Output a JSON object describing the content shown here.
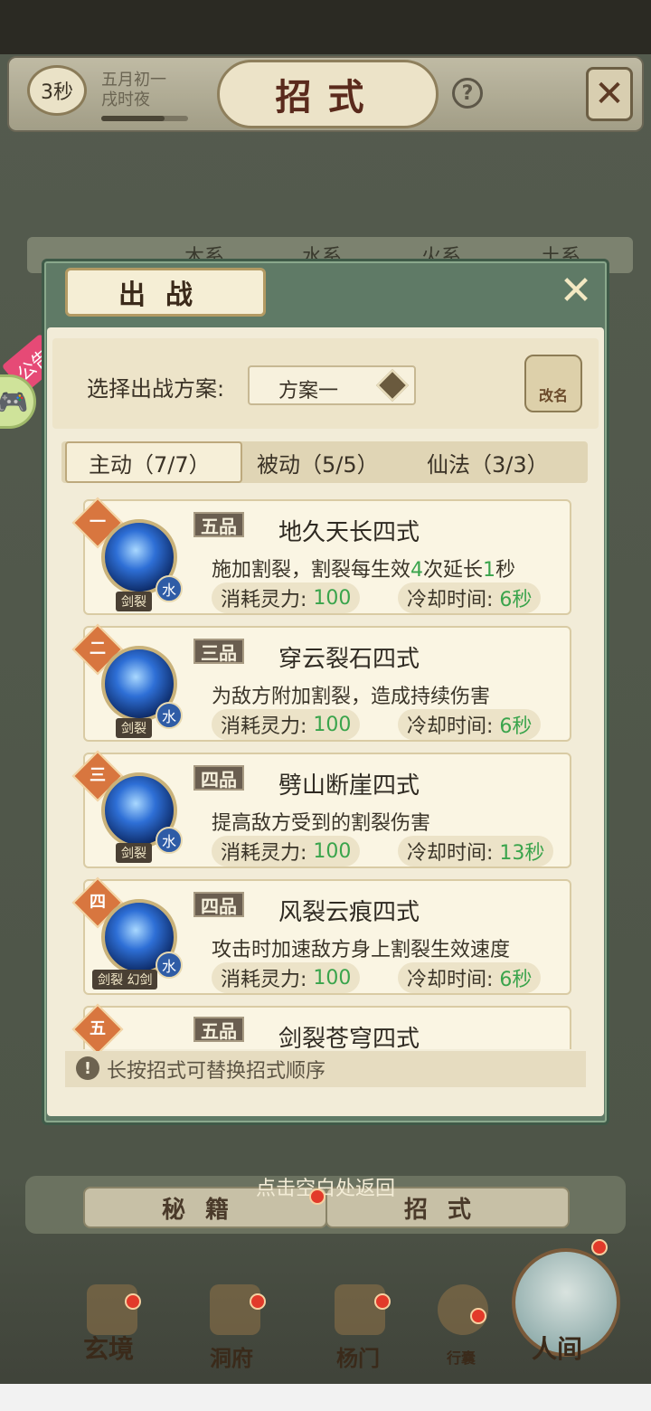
{
  "header": {
    "timer": "3秒",
    "date_line1": "五月初一",
    "date_line2": "戌时夜",
    "title": "招式",
    "help": "?"
  },
  "background_tabs": [
    "木系",
    "水系",
    "火系",
    "土系"
  ],
  "notice_tag": "公告",
  "modal": {
    "title": "出战",
    "plan_label": "选择出战方案:",
    "plan_value": "方案一",
    "rename_label": "改名",
    "tabs": [
      {
        "label": "主动（7/7）",
        "active": true
      },
      {
        "label": "被动（5/5）",
        "active": false
      },
      {
        "label": "仙法（3/3）",
        "active": false
      }
    ],
    "skills": [
      {
        "rank": "一",
        "grade": "五品",
        "name": "地久天长四式",
        "desc_pre": "施加割裂，割裂每生效",
        "desc_n1": "4",
        "desc_mid": "次延长",
        "desc_n2": "1",
        "desc_post": "秒",
        "element": "水",
        "tag": "剑裂",
        "cost_label": "消耗灵力:",
        "cost": "100",
        "cd_label": "冷却时间:",
        "cd": "6秒"
      },
      {
        "rank": "二",
        "grade": "三品",
        "name": "穿云裂石四式",
        "desc": "为敌方附加割裂，造成持续伤害",
        "element": "水",
        "tag": "剑裂",
        "cost_label": "消耗灵力:",
        "cost": "100",
        "cd_label": "冷却时间:",
        "cd": "6秒"
      },
      {
        "rank": "三",
        "grade": "四品",
        "name": "劈山断崖四式",
        "desc": "提高敌方受到的割裂伤害",
        "element": "水",
        "tag": "剑裂",
        "cost_label": "消耗灵力:",
        "cost": "100",
        "cd_label": "冷却时间:",
        "cd": "13秒"
      },
      {
        "rank": "四",
        "grade": "四品",
        "name": "风裂云痕四式",
        "desc": "攻击时加速敌方身上割裂生效速度",
        "element": "水",
        "tag": "剑裂 幻剑",
        "cost_label": "消耗灵力:",
        "cost": "100",
        "cd_label": "冷却时间:",
        "cd": "6秒"
      },
      {
        "rank": "五",
        "grade": "五品",
        "name": "剑裂苍穹四式"
      }
    ],
    "hint": "长按招式可替换招式顺序"
  },
  "return_hint": "点击空白处返回",
  "bottom_tabs": [
    "秘籍",
    "招式"
  ],
  "nav": [
    "玄境",
    "洞府",
    "杨门",
    "行囊",
    "人间"
  ],
  "colors": {
    "accent_green": "#3aa44c",
    "rank_orange": "#d8763f",
    "modal_green": "#5f7a66"
  }
}
